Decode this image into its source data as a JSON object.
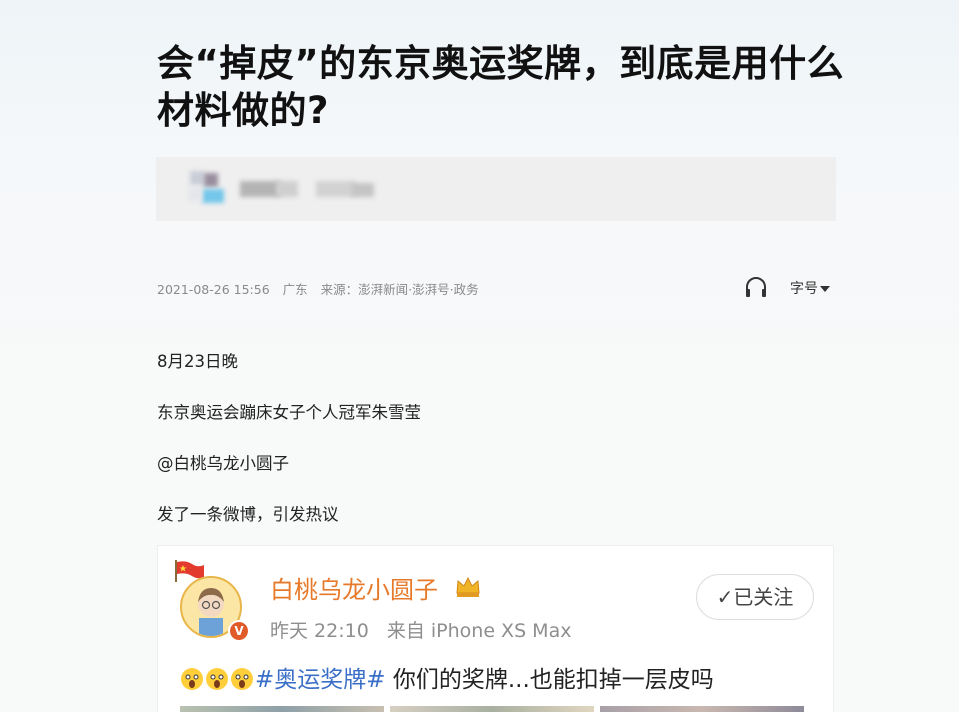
{
  "article": {
    "title": "会“掉皮”的东京奥运奖牌，到底是用什么材料做的?",
    "meta": {
      "datetime": "2021-08-26 15:56",
      "location": "广东",
      "source": "来源：澎湃新闻·澎湃号·政务"
    },
    "font_size_label": "字号",
    "paragraphs": [
      "8月23日晚",
      "东京奥运会蹦床女子个人冠军朱雪莹",
      "@白桃乌龙小圆子",
      "发了一条微博，引发热议"
    ]
  },
  "weibo_embed": {
    "username": "白桃乌龙小圆子",
    "time": "昨天 22:10",
    "device": "来自 iPhone XS Max",
    "follow_label": "✓已关注",
    "topic": "#奥运奖牌#",
    "text": " 你们的奖牌...也能扣掉一层皮吗",
    "verified_badge": "V"
  },
  "icons": {
    "listen": "headphones-icon",
    "caret": "caret-down-icon",
    "crown": "crown-icon",
    "flag": "flag-icon"
  },
  "colors": {
    "weibo_name": "#e77a2a",
    "topic": "#3b6fc7",
    "meta_text": "#8a8a8a"
  }
}
